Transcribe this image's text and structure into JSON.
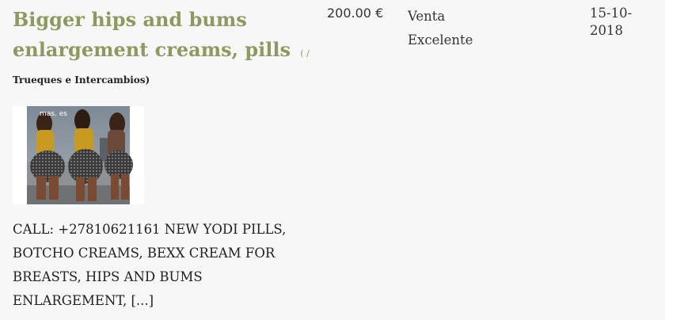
{
  "listing": {
    "title": "Bigger hips and bums enlargement creams, pills",
    "category_open": "( /",
    "category": "Trueques e Intercambios)",
    "image_alt": "Listing photo",
    "watermark": "mas. es",
    "description": "CALL: +27810621161 NEW YODI PILLS, BOTCHO CREAMS, BEXX CREAM FOR BREASTS, HIPS AND BUMS ENLARGEMENT, [...]",
    "price": "200.00 €",
    "type": "Venta",
    "condition": "Excelente",
    "date": "15-10-2018",
    "colors": {
      "title": "#8c9a5f",
      "background": "#f7f7f7"
    }
  }
}
